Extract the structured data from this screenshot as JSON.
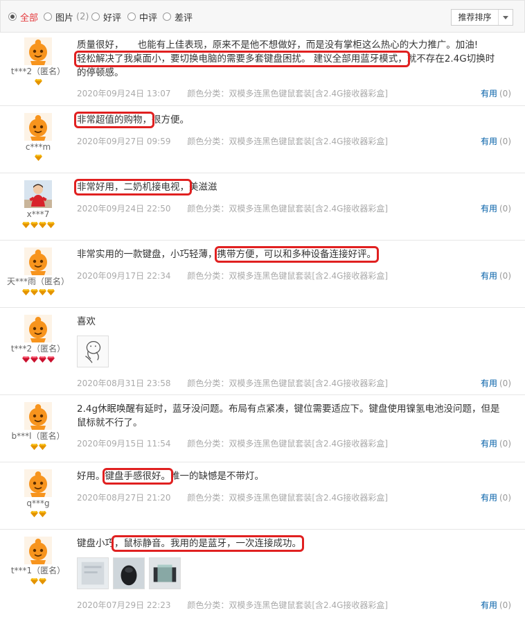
{
  "filters": {
    "all": "全部",
    "pictures": "图片",
    "pictures_count": "(2)",
    "good": "好评",
    "medium": "中评",
    "bad": "差评",
    "sort_label": "推荐排序"
  },
  "useful_label": "有用",
  "useful_count": "(0)",
  "colors": {
    "highlight_box": "#e02020",
    "link": "#005ea7",
    "active_tab": "#e4393c"
  },
  "reviews": [
    {
      "user": "t***2（匿名）",
      "avatar": "orange-mascot",
      "badge_count": 1,
      "text_lines": [
        "质量很好，　　也能有上佳表现，原来不是他不想做好，而是没有掌柜这么热心的大力推广。加油!",
        "轻松解决了我桌面小，要切换电脑的需要多套键盘困扰。 建议全部用蓝牙模式，就不存在2.4G切换时",
        "的停顿感。"
      ],
      "date": "2020年09月24日 13:07",
      "variant": "颜色分类：双模多连黑色键鼠套装[含2.4G接收器彩盒]"
    },
    {
      "user": "c***m",
      "avatar": "orange-mascot",
      "badge_count": 1,
      "text_highlight": "非常超值的购物，",
      "text_rest": "很方便。",
      "date": "2020年09月27日 09:59",
      "variant": "颜色分类：双模多连黑色键鼠套装[含2.4G接收器彩盒]"
    },
    {
      "user": "x***7",
      "avatar": "child-photo",
      "badge_count": 4,
      "text_highlight": "非常好用，二奶机接电视，",
      "text_rest": "美滋滋",
      "date": "2020年09月24日 22:50",
      "variant": "颜色分类：双模多连黑色键鼠套装[含2.4G接收器彩盒]"
    },
    {
      "user": "天***雨（匿名）",
      "avatar": "orange-mascot",
      "badge_count": 4,
      "text_plain": "非常实用的一款键盘，小巧轻薄，",
      "text_highlight": "携带方便，可以和多种设备连接好评。",
      "date": "2020年09月17日 22:34",
      "variant": "颜色分类：双模多连黑色键鼠套装[含2.4G接收器彩盒]"
    },
    {
      "user": "t***2（匿名）",
      "avatar": "orange-mascot",
      "badge_count": 4,
      "text": "喜欢",
      "date": "2020年08月31日 23:58",
      "variant": "颜色分类：双模多连黑色键鼠套装[含2.4G接收器彩盒]"
    },
    {
      "user": "b***l（匿名）",
      "avatar": "orange-mascot",
      "badge_count": 2,
      "text_lines": [
        "2.4g休眠唤醒有延时，蓝牙没问题。布局有点紧凑，键位需要适应下。键盘使用镍氢电池没问题，但是",
        "鼠标就不行了。"
      ],
      "date": "2020年09月15日 11:54",
      "variant": "颜色分类：双模多连黑色键鼠套装[含2.4G接收器彩盒]"
    },
    {
      "user": "q***g",
      "avatar": "orange-mascot",
      "badge_count": 2,
      "text_plain": "好用。",
      "text_highlight": "键盘手感很好。",
      "text_rest": "唯一的缺憾是不带灯。",
      "date": "2020年08月27日 21:20",
      "variant": "颜色分类：双模多连黑色键鼠套装[含2.4G接收器彩盒]"
    },
    {
      "user": "t***1（匿名）",
      "avatar": "orange-mascot",
      "badge_count": 2,
      "text_plain": "键盘小巧",
      "text_highlight": "，鼠标静音。我用的是蓝牙，一次连接成功。",
      "date": "2020年07月29日 22:23",
      "variant": "颜色分类：双模多连黑色键鼠套装[含2.4G接收器彩盒]"
    }
  ]
}
